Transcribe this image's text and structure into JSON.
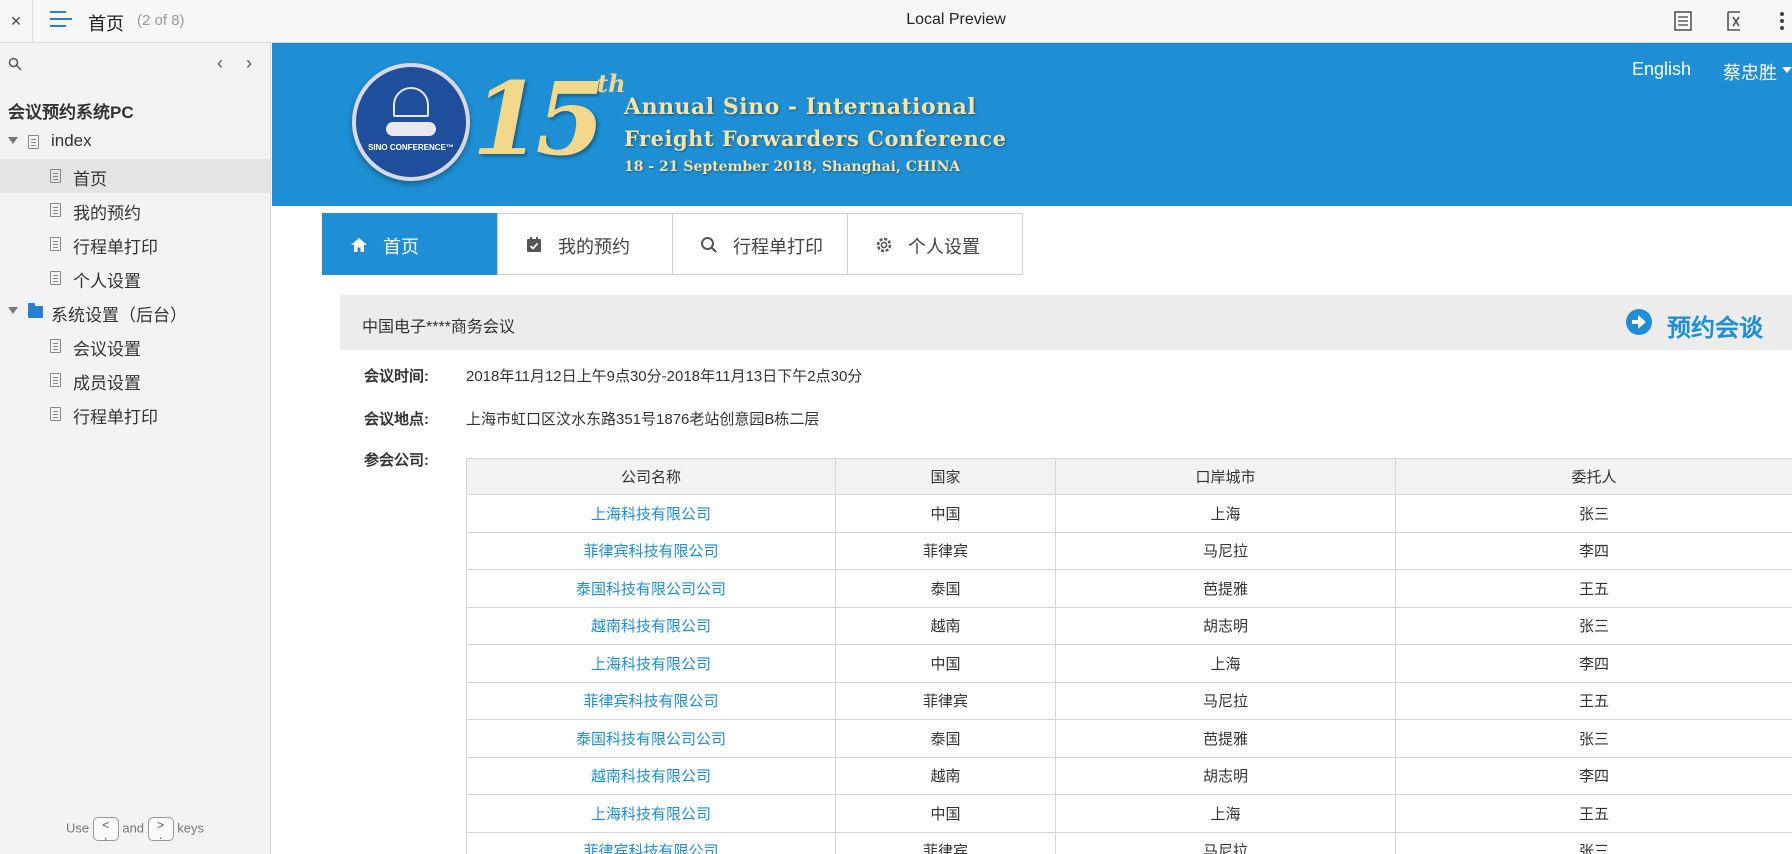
{
  "toolbar": {
    "close": "×",
    "page_name": "首页",
    "page_count": "(2 of 8)",
    "preview_title": "Local Preview"
  },
  "sidebar": {
    "nav_prev": "‹",
    "nav_next": "›",
    "project_title": "会议预约系统PC",
    "tree": [
      {
        "label": "index",
        "type": "group"
      },
      {
        "label": "首页",
        "type": "page",
        "selected": true
      },
      {
        "label": "我的预约",
        "type": "page"
      },
      {
        "label": "行程单打印",
        "type": "page"
      },
      {
        "label": "个人设置",
        "type": "page"
      },
      {
        "label": "系统设置（后台）",
        "type": "folder"
      },
      {
        "label": "会议设置",
        "type": "page"
      },
      {
        "label": "成员设置",
        "type": "page"
      },
      {
        "label": "行程单打印",
        "type": "page"
      }
    ],
    "hint": {
      "use": "Use",
      "key_prev": "<\n,",
      "and": "and",
      "key_next": ">\n.",
      "keys": "keys"
    }
  },
  "banner": {
    "logo_text": "SINO CONFERENCE™",
    "big_number": "15",
    "ordinal": "th",
    "line1": "Annual Sino - International",
    "line2": "Freight Forwarders Conference",
    "line3": "18 - 21 September 2018, Shanghai, CHINA",
    "lang_link": "English",
    "user_name": "蔡忠胜"
  },
  "tabs": [
    {
      "label": "首页",
      "icon": "home-icon",
      "active": true
    },
    {
      "label": "我的预约",
      "icon": "calendar-check-icon",
      "active": false
    },
    {
      "label": "行程单打印",
      "icon": "search-icon",
      "active": false
    },
    {
      "label": "个人设置",
      "icon": "gear-icon",
      "active": false
    }
  ],
  "meeting": {
    "name": "中国电子****商务会议",
    "book_label": "预约会谈",
    "time_label": "会议时间:",
    "time_value": "2018年11月12日上午9点30分-2018年11月13日下午2点30分",
    "location_label": "会议地点:",
    "location_value": "上海市虹口区汶水东路351号1876老站创意园B栋二层",
    "companies_label": "参会公司:"
  },
  "table": {
    "headers": [
      "公司名称",
      "国家",
      "口岸城市",
      "委托人"
    ],
    "rows": [
      [
        "上海科技有限公司",
        "中国",
        "上海",
        "张三"
      ],
      [
        "菲律宾科技有限公司",
        "菲律宾",
        "马尼拉",
        "李四"
      ],
      [
        "泰国科技有限公司公司",
        "泰国",
        "芭提雅",
        "王五"
      ],
      [
        "越南科技有限公司",
        "越南",
        "胡志明",
        "张三"
      ],
      [
        "上海科技有限公司",
        "中国",
        "上海",
        "李四"
      ],
      [
        "菲律宾科技有限公司",
        "菲律宾",
        "马尼拉",
        "王五"
      ],
      [
        "泰国科技有限公司公司",
        "泰国",
        "芭提雅",
        "张三"
      ],
      [
        "越南科技有限公司",
        "越南",
        "胡志明",
        "李四"
      ],
      [
        "上海科技有限公司",
        "中国",
        "上海",
        "王五"
      ],
      [
        "菲律宾科技有限公司",
        "菲律宾",
        "马尼拉",
        "张三"
      ]
    ]
  },
  "colors": {
    "accent": "#1e8fd4",
    "banner_gold": "#f3d78a",
    "sidebar_bg": "#f3f3f3"
  }
}
